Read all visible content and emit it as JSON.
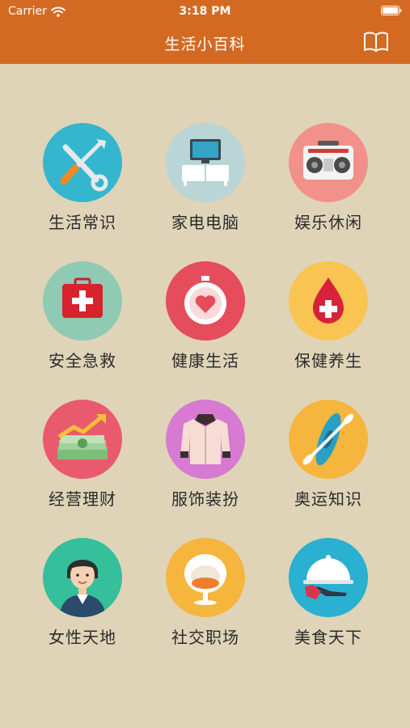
{
  "status_bar": {
    "carrier": "Carrier",
    "time": "3:18 PM"
  },
  "nav": {
    "title": "生活小百科",
    "right_icon": "book-icon"
  },
  "colors": {
    "header": "#d46a22",
    "background": "#dfd4b8"
  },
  "categories": [
    {
      "label": "生活常识",
      "icon": "tools-icon",
      "color": "#35b6cf"
    },
    {
      "label": "家电电脑",
      "icon": "tv-cabinet-icon",
      "color": "#b9d5d6"
    },
    {
      "label": "娱乐休闲",
      "icon": "boombox-icon",
      "color": "#f1918a"
    },
    {
      "label": "安全急救",
      "icon": "first-aid-kit-icon",
      "color": "#8fcab4"
    },
    {
      "label": "健康生活",
      "icon": "heart-stopwatch-icon",
      "color": "#e54c5c"
    },
    {
      "label": "保健养生",
      "icon": "blood-drop-icon",
      "color": "#f9c452"
    },
    {
      "label": "经营理财",
      "icon": "money-growth-icon",
      "color": "#ea5a6e"
    },
    {
      "label": "服饰装扮",
      "icon": "coat-icon",
      "color": "#d77ad2"
    },
    {
      "label": "奥运知识",
      "icon": "kayak-icon",
      "color": "#f6b53c"
    },
    {
      "label": "女性天地",
      "icon": "woman-icon",
      "color": "#35bf9b"
    },
    {
      "label": "社交职场",
      "icon": "egg-chair-icon",
      "color": "#f6b53c"
    },
    {
      "label": "美食天下",
      "icon": "cloche-icon",
      "color": "#2ab0d0"
    }
  ]
}
